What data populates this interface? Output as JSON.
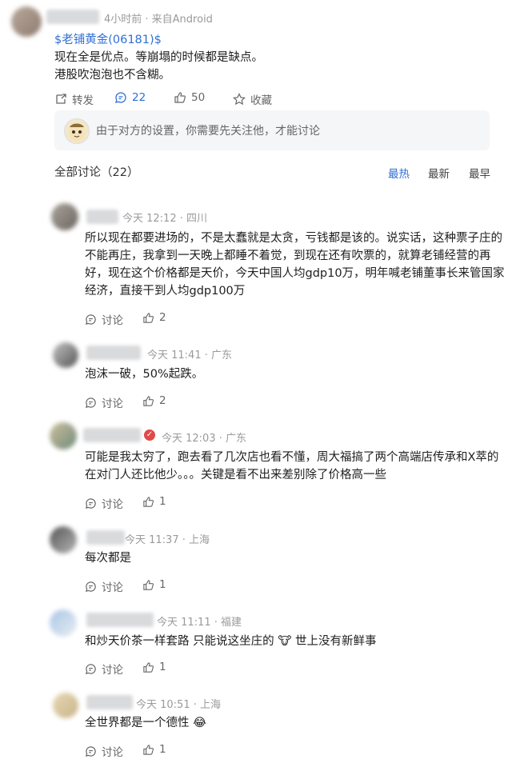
{
  "post": {
    "time_source": "4小时前 · 来自Android",
    "stock_tag": "$老铺黄金(06181)$",
    "lines": [
      "现在全是优点。等崩塌的时候都是缺点。",
      "港股吹泡泡也不含糊。"
    ],
    "actions": {
      "repost": "转发",
      "comments": "22",
      "likes": "50",
      "favorite": "收藏"
    }
  },
  "notice": {
    "text": "由于对方的设置，你需要先关注他，才能讨论"
  },
  "discussion": {
    "title": "全部讨论（22）",
    "sort": [
      "最热",
      "最新",
      "最早"
    ],
    "active_sort": "最热"
  },
  "comments": [
    {
      "meta": "今天 12:12 · 四川",
      "lines": [
        "所以现在都要进场的，不是太蠢就是太贪，亏钱都是该的。说实话，这种票子庄的",
        "不能再庄，我拿到一天晚上都睡不着觉，到现在还有吹票的，就算老铺经营的再",
        "好，现在这个价格都是天价，今天中国人均gdp10万，明年喊老铺董事长来管国家",
        "经济，直接干到人均gdp100万"
      ],
      "reply_label": "讨论",
      "likes": "2"
    },
    {
      "meta": "今天 11:41 · 广东",
      "lines": [
        "泡沫一破，50%起跌。"
      ],
      "reply_label": "讨论",
      "likes": "2"
    },
    {
      "meta": "今天 12:03 · 广东",
      "lines": [
        "可能是我太穷了，跑去看了几次店也看不懂，周大福搞了两个高端店传承和X萃的",
        "在对门人还比他少。。。关键是看不出来差别除了价格高一些"
      ],
      "reply_label": "讨论",
      "likes": "1"
    },
    {
      "meta": "今天 11:37 · 上海",
      "lines": [
        "每次都是"
      ],
      "reply_label": "讨论",
      "likes": "1"
    },
    {
      "meta": "今天 11:11 · 福建",
      "lines": [
        "和炒天价茶一样套路 只能说这坐庄的 🐮 世上没有新鲜事"
      ],
      "reply_label": "讨论",
      "likes": "1"
    },
    {
      "meta": "今天 10:51 · 上海",
      "lines": [
        "全世界都是一个德性 😂"
      ],
      "reply_label": "讨论",
      "likes": "1"
    }
  ],
  "colors": {
    "link": "#2f6fd6",
    "meta": "#9a9a9a",
    "notice_bg": "#f5f6f8"
  }
}
